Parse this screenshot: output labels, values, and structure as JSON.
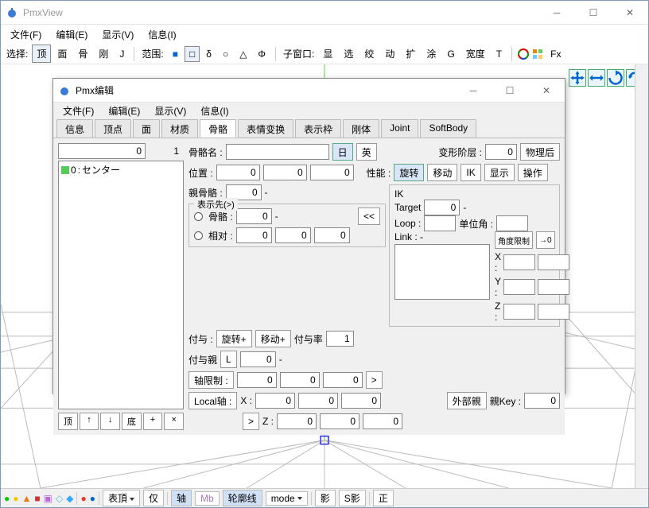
{
  "main_window": {
    "title": "PmxView",
    "menu": [
      "文件(F)",
      "编辑(E)",
      "显示(V)",
      "信息(I)"
    ],
    "toolbar": {
      "select_label": "选择:",
      "select_buttons": [
        "顶",
        "面",
        "骨",
        "刚",
        "J"
      ],
      "range_label": "范围:",
      "range_buttons": [
        "■",
        "□",
        "δ",
        "○",
        "△",
        "Φ"
      ],
      "child_label": "子窗口:",
      "child_buttons": [
        "显",
        "选",
        "绞",
        "动",
        "扩",
        "涂",
        "G",
        "宽度",
        "T"
      ],
      "fx": "Fx"
    },
    "status": {
      "surface": "表頂",
      "jin": "仅",
      "axis": "轴",
      "mb": "Mb",
      "outline": "轮廓线",
      "mode": "mode",
      "shadow": "影",
      "sshadow": "S影",
      "plus": "正"
    }
  },
  "editor": {
    "title": "Pmx编辑",
    "menu": [
      "文件(F)",
      "编辑(E)",
      "显示(V)",
      "信息(I)"
    ],
    "tabs": [
      "信息",
      "顶点",
      "面",
      "材质",
      "骨骼",
      "表情变换",
      "表示枠",
      "刚体",
      "Joint",
      "SoftBody"
    ],
    "active_tab": 4,
    "index_value": "0",
    "index_total": "1",
    "list_items": [
      {
        "idx": "0",
        "name": "センター"
      }
    ],
    "left_btm": [
      "顶",
      "↑",
      "↓",
      "底",
      "+",
      "×"
    ],
    "bone_name_label": "骨骼名 :",
    "bone_name": "",
    "lang_jp": "日",
    "lang_en": "英",
    "deform_label": "变形阶层 :",
    "deform_value": "0",
    "phys_after": "物理后",
    "pos_label": "位置 :",
    "pos": [
      "0",
      "0",
      "0"
    ],
    "perf_label": "性能 :",
    "perf_buttons": [
      "旋转",
      "移动",
      "IK",
      "显示",
      "操作"
    ],
    "parent_label": "親骨骼 :",
    "parent_value": "0",
    "display_group_label": "表示先(>)",
    "disp_bone_label": "骨骼 :",
    "disp_bone_value": "0",
    "disp_rel_label": "相对 :",
    "disp_rel": [
      "0",
      "0",
      "0"
    ],
    "btn_prev": "<<",
    "ik_label": "IK",
    "ik_target_label": "Target",
    "ik_target_value": "0",
    "ik_loop_label": "Loop :",
    "ik_loop_value": "",
    "ik_unit_label": "单位角 :",
    "ik_unit_value": "",
    "ik_link_label": "Link : -",
    "angle_limit": "角度限制",
    "to0": "→0",
    "xyz_labels": [
      "X :",
      "Y :",
      "Z :"
    ],
    "assign_label": "付与 :",
    "assign_rot": "旋转+",
    "assign_mov": "移动+",
    "assign_rate_label": "付与率",
    "assign_rate": "1",
    "assign_parent_label": "付与親",
    "assign_parent_btn": "L",
    "assign_parent_value": "0",
    "axis_limit_label": "轴限制 :",
    "axis_limit": [
      "0",
      "0",
      "0"
    ],
    "btn_next": ">",
    "local_axis_label": "Local轴 :",
    "local_x_label": "X :",
    "local_x": [
      "0",
      "0",
      "0"
    ],
    "local_z_label": "Z :",
    "local_z": [
      "0",
      "0",
      "0"
    ],
    "ext_parent": "外部親",
    "parent_key_label": "親Key :",
    "parent_key_value": "0"
  }
}
